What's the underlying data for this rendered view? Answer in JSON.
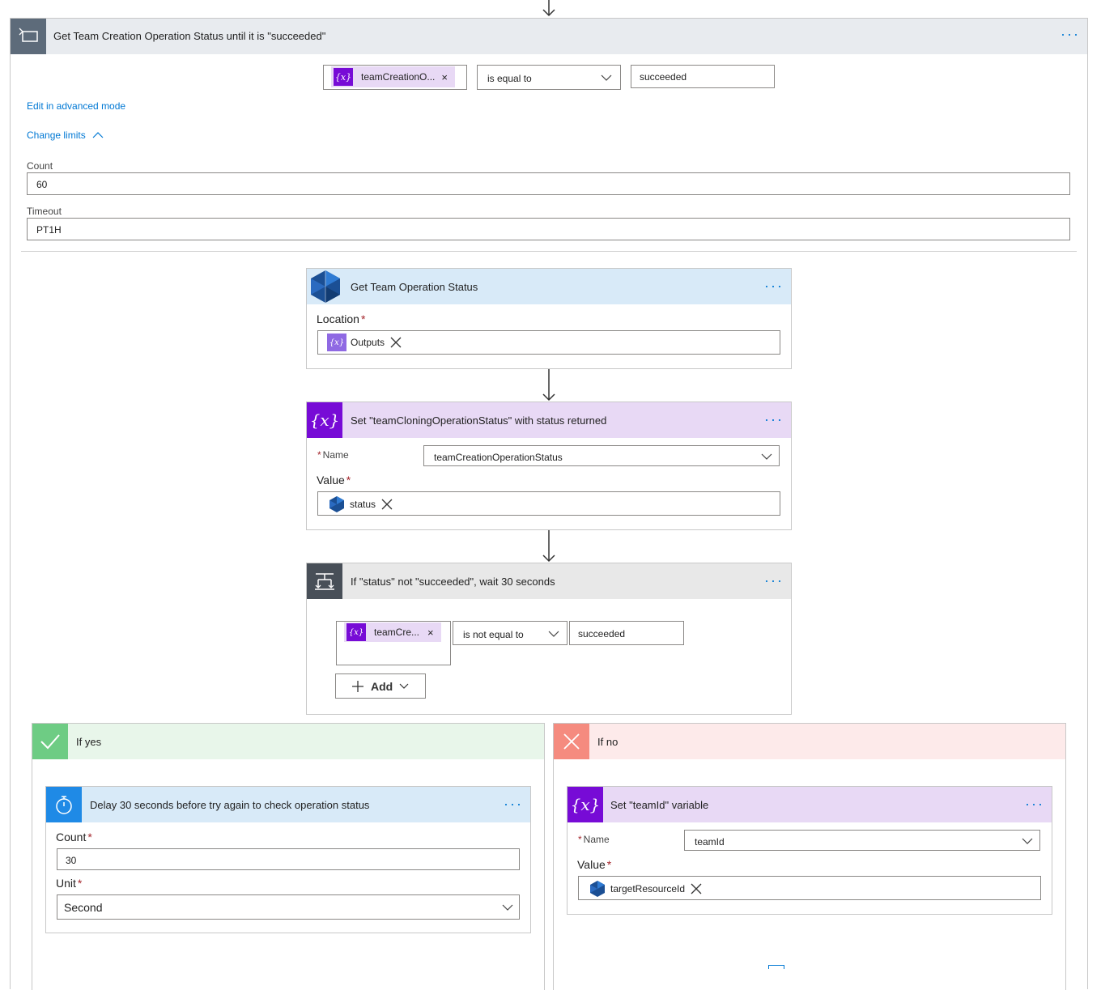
{
  "until": {
    "title": "Get Team Creation Operation Status until it is \"succeeded\"",
    "token": "teamCreationO...",
    "operator": "is equal to",
    "value": "succeeded",
    "advanced_link": "Edit in advanced mode",
    "limits_link": "Change limits",
    "count_label": "Count",
    "count_value": "60",
    "timeout_label": "Timeout",
    "timeout_value": "PT1H"
  },
  "get_status": {
    "title": "Get Team Operation Status",
    "location_label": "Location",
    "location_token": "Outputs"
  },
  "set_var": {
    "title": "Set \"teamCloningOperationStatus\" with status returned",
    "name_label": "Name",
    "name_value": "teamCreationOperationStatus",
    "value_label": "Value",
    "value_token": "status"
  },
  "condition": {
    "title": "If \"status\" not \"succeeded\", wait 30 seconds",
    "token": "teamCre...",
    "operator": "is not equal to",
    "value": "succeeded",
    "add_label": "Add"
  },
  "if_yes": {
    "header": "If yes",
    "delay_title": "Delay 30 seconds before try again to check operation status",
    "count_label": "Count",
    "count_value": "30",
    "unit_label": "Unit",
    "unit_value": "Second"
  },
  "if_no": {
    "header": "If no",
    "set_title": "Set \"teamId\" variable",
    "name_label": "Name",
    "name_value": "teamId",
    "value_label": "Value",
    "value_token": "targetResourceId"
  },
  "required_mark": "*",
  "colors": {
    "accent": "#0078d4",
    "variable": "#770bd6",
    "variable_header": "#e8d9f5",
    "action_header": "#d8eaf8",
    "until_header": "#e8ebef",
    "yes_green": "#6ecc84",
    "no_red": "#f58b7f"
  }
}
